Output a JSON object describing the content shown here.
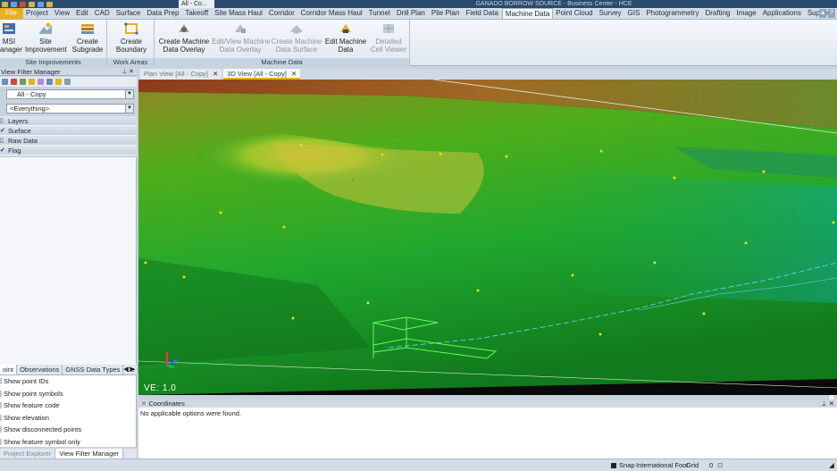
{
  "window": {
    "title": "GANADO BORROW SOURCE - Business Center - HCE",
    "qat_combo": "All - Co..."
  },
  "ribbon_tabs": [
    {
      "label": "File",
      "kind": "file"
    },
    {
      "label": "Project"
    },
    {
      "label": "View"
    },
    {
      "label": "Edit"
    },
    {
      "label": "CAD"
    },
    {
      "label": "Surface"
    },
    {
      "label": "Data Prep"
    },
    {
      "label": "Takeoff"
    },
    {
      "label": "Site Mass Haul"
    },
    {
      "label": "Corridor"
    },
    {
      "label": "Corridor Mass Haul"
    },
    {
      "label": "Tunnel"
    },
    {
      "label": "Drill Plan"
    },
    {
      "label": "Pile Plan"
    },
    {
      "label": "Field Data"
    },
    {
      "label": "Machine Data",
      "active": true
    },
    {
      "label": "Point Cloud"
    },
    {
      "label": "Survey"
    },
    {
      "label": "GIS"
    },
    {
      "label": "Photogrammetry"
    },
    {
      "label": "Drafting"
    },
    {
      "label": "Image"
    },
    {
      "label": "Applications"
    },
    {
      "label": "Support"
    }
  ],
  "ribbon": {
    "groups": {
      "site_improvements": "Site Improvements",
      "work_areas": "Work Areas",
      "machine_data": "Machine Data"
    },
    "buttons": {
      "msi_manager": "MSI\nanager",
      "site_improvement": "Site\nImprovement",
      "create_subgrade": "Create\nSubgrade",
      "create_boundary": "Create\nBoundary",
      "create_machine_data_overlay": "Create Machine\nData Overlay",
      "edit_view_overlay": "Edit/View Machine\nData Overlay",
      "create_machine_data_surface": "Create Machine\nData Surface",
      "edit_machine_data": "Edit Machine\nData",
      "detailed_cell_viewer": "Detailed\nCell Viewer"
    }
  },
  "view_filter_manager": {
    "title": "View Filter Manager",
    "filter_select": "All - Copy",
    "everything_select": "<Everything>",
    "layers": [
      {
        "label": "Layers",
        "checked": false
      },
      {
        "label": "Surface",
        "checked": true
      },
      {
        "label": "Raw Data",
        "checked": false
      },
      {
        "label": "Flag",
        "checked": true
      }
    ]
  },
  "lower_panel": {
    "tabs": [
      {
        "label": "oint",
        "active": true
      },
      {
        "label": "Observations"
      },
      {
        "label": "GNSS Data Types"
      },
      {
        "label": "De"
      }
    ],
    "options": [
      "Show point IDs",
      "Show point symbols",
      "Show feature code",
      "Show elevation",
      "Show disconnected points",
      "Show feature symbol only"
    ],
    "bottom_tabs": [
      {
        "label": "Project Explorer"
      },
      {
        "label": "View Filter Manager",
        "active": true
      }
    ]
  },
  "document_tabs": [
    {
      "label": "Plan View [All - Copy]"
    },
    {
      "label": "3D View [All - Copy]",
      "active": true
    }
  ],
  "view3d": {
    "ve_label": "VE: 1.0"
  },
  "coordinates": {
    "title": "Coordinates",
    "message": "No applicable options were found."
  },
  "status_bar": {
    "snap": "Snap",
    "units": "International Foot",
    "grid": "Grid",
    "grid_value": "0"
  },
  "colors": {
    "accent": "#e8b21a",
    "ribbon_bg": "#dfe7ef",
    "title_bar": "#284a6e"
  }
}
